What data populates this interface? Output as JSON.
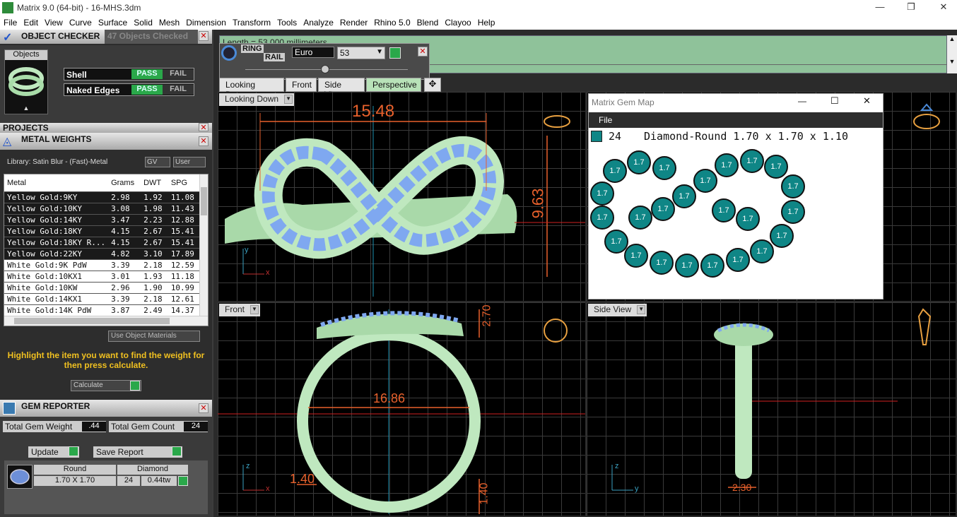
{
  "window": {
    "title": "Matrix 9.0 (64-bit) - 16-MHS.3dm",
    "min": "—",
    "max": "❐",
    "close": "✕"
  },
  "menu": [
    "File",
    "Edit",
    "View",
    "Curve",
    "Surface",
    "Solid",
    "Mesh",
    "Dimension",
    "Transform",
    "Tools",
    "Analyze",
    "Render",
    "Rhino 5.0",
    "Blend",
    "Clayoo",
    "Help"
  ],
  "object_checker": {
    "title": "OBJECT CHECKER",
    "objects_checked": "47 Objects Checked",
    "objects_label": "Objects",
    "checks": [
      {
        "label": "Shell",
        "pass": "PASS",
        "fail": "FAIL"
      },
      {
        "label": "Naked Edges",
        "pass": "PASS",
        "fail": "FAIL"
      }
    ]
  },
  "projects": {
    "title": "PROJECTS"
  },
  "metal_weights": {
    "title": "METAL WEIGHTS",
    "library": "Library: Satin Blur - (Fast)-Metal",
    "gv": "GV",
    "user": "User",
    "columns": [
      "Metal",
      "Grams",
      "DWT",
      "SPG"
    ],
    "rows": [
      [
        "Yellow Gold:9KY",
        "2.98",
        "1.92",
        "11.08"
      ],
      [
        "Yellow Gold:10KY",
        "3.08",
        "1.98",
        "11.43"
      ],
      [
        "Yellow Gold:14KY",
        "3.47",
        "2.23",
        "12.88"
      ],
      [
        "Yellow Gold:18KY",
        "4.15",
        "2.67",
        "15.41"
      ],
      [
        "Yellow Gold:18KY R...",
        "4.15",
        "2.67",
        "15.41"
      ],
      [
        "Yellow Gold:22KY",
        "4.82",
        "3.10",
        "17.89"
      ],
      [
        "White Gold:9K PdW",
        "3.39",
        "2.18",
        "12.59"
      ],
      [
        "White Gold:10KX1",
        "3.01",
        "1.93",
        "11.18"
      ],
      [
        "White Gold:10KW",
        "2.96",
        "1.90",
        "10.99"
      ],
      [
        "White Gold:14KX1",
        "3.39",
        "2.18",
        "12.61"
      ],
      [
        "White Gold:14K PdW",
        "3.87",
        "2.49",
        "14.37"
      ]
    ],
    "use_object_materials": "Use Object Materials",
    "hint": "Highlight the item you want to find the weight for then press calculate.",
    "calculate": "Calculate"
  },
  "gem_reporter": {
    "title": "GEM REPORTER",
    "total_weight_label": "Total Gem Weight",
    "total_weight": ".44",
    "total_count_label": "Total Gem Count",
    "total_count": "24",
    "update": "Update",
    "save_report": "Save Report",
    "shape": "Round",
    "type": "Diamond",
    "size": "1.70 X 1.70",
    "count": "24",
    "tw": "0.44tw"
  },
  "command": {
    "line": "Length = 53.000 millimeters"
  },
  "ring_rail": {
    "label1": "RING",
    "label2": "RAIL",
    "standard": "Euro",
    "size": "53"
  },
  "tabs": [
    "Looking Down",
    "Front",
    "Side View",
    "Perspective"
  ],
  "viewports": {
    "top": {
      "label": "Looking Down",
      "dim_w": "15.48",
      "dim_h": "9.63"
    },
    "front": {
      "label": "Front",
      "dim_top": "2.70",
      "dim_inner": "16.86",
      "dim_band": "1.40",
      "dim_bottom": "1.40"
    },
    "side": {
      "label": "Side View",
      "dim": "2.30"
    }
  },
  "gem_map": {
    "title": "Matrix Gem Map",
    "file": "File",
    "count": "24",
    "desc": "Diamond-Round 1.70 x 1.70 x 1.10",
    "gem_label": "1.7"
  },
  "axes": {
    "x": "x",
    "y": "y",
    "z": "z"
  },
  "colors": {
    "accent": "#2aa84a",
    "dim": "#e8612c",
    "ring": "#bfe8bf",
    "gem": "#7fa8f0",
    "teal": "#0f8686"
  }
}
